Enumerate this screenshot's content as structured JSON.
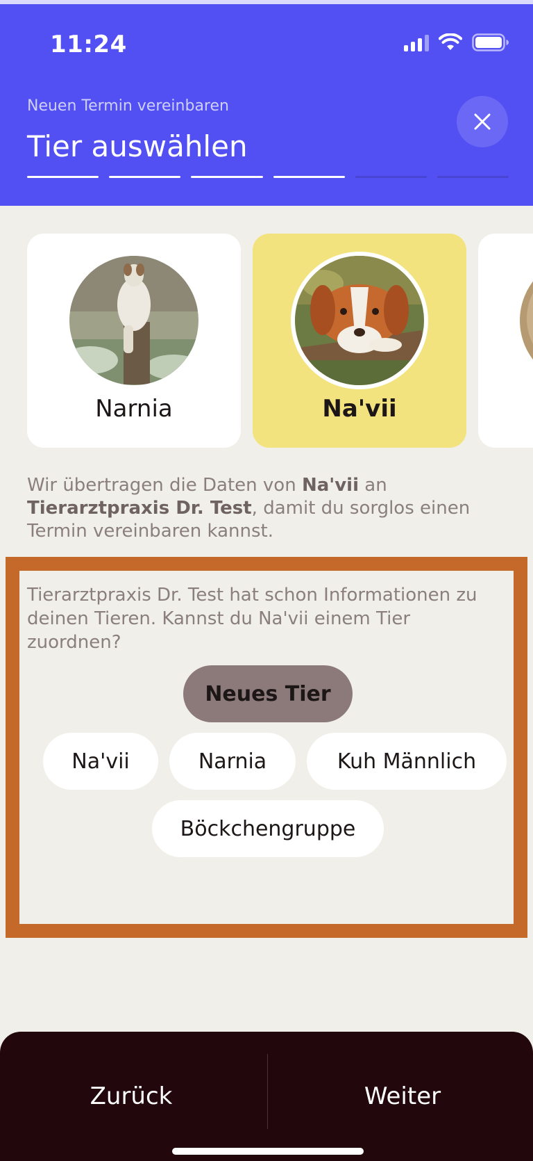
{
  "status_bar": {
    "time": "11:24",
    "icons": [
      "signal-icon",
      "wifi-icon",
      "battery-icon"
    ]
  },
  "header": {
    "subtitle": "Neuen Termin vereinbaren",
    "title": "Tier auswählen",
    "close_icon": "close-icon",
    "progress": {
      "completed_steps": 4,
      "total_steps": 6
    }
  },
  "pets": [
    {
      "name": "Narnia",
      "selected": false
    },
    {
      "name": "Na'vii",
      "selected": true
    },
    {
      "name": "",
      "selected": false
    }
  ],
  "info": {
    "part1": "Wir übertragen die Daten von ",
    "pet": "Na'vii",
    "part2": " an ",
    "practice": "Tierarztpraxis Dr. Test",
    "part3": ", damit du sorglos einen Termin vereinbaren kannst."
  },
  "match": {
    "question": "Tierarztpraxis Dr. Test hat schon Informationen zu deinen Tieren. Kannst du Na'vii einem Tier zuordnen?",
    "primary_option": "Neues Tier",
    "options": [
      "Na'vii",
      "Narnia",
      "Kuh Männlich",
      "Böckchengruppe"
    ]
  },
  "bottom_bar": {
    "back_label": "Zurück",
    "next_label": "Weiter"
  },
  "colors": {
    "header_bg": "#5250F2",
    "page_bg": "#F1EFEA",
    "selected_card": "#F2E37E",
    "highlight_border": "#C4692A",
    "primary_chip": "#8B7A79",
    "bottom_bar_bg": "#22080C"
  }
}
